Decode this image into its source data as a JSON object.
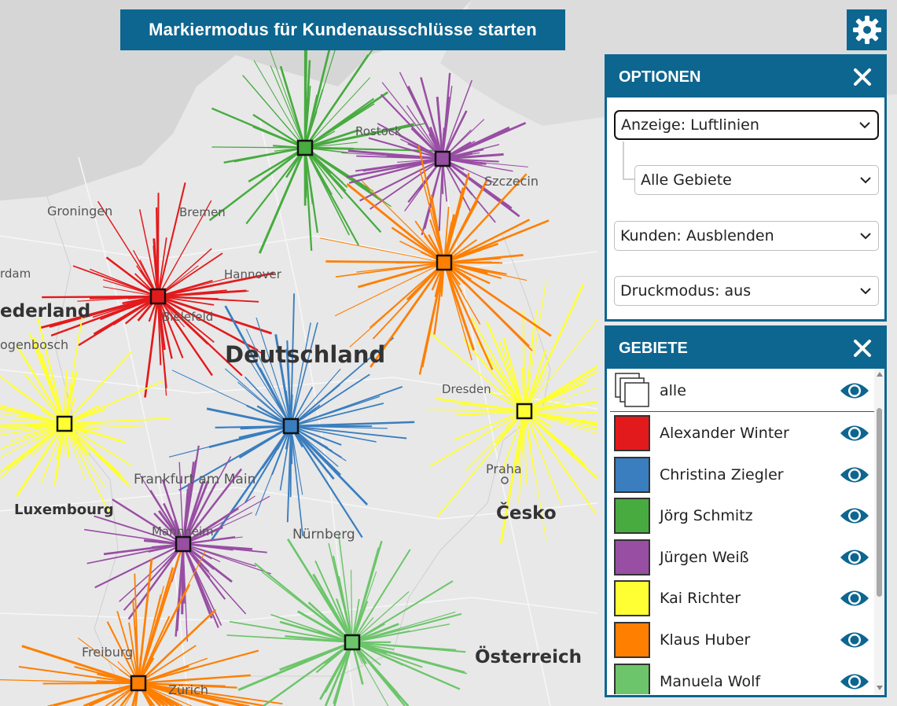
{
  "top_button": {
    "label": "Markiermodus für Kundenausschlüsse starten"
  },
  "settings_icon": "gear-icon",
  "map": {
    "labels": {
      "groningen": "Groningen",
      "amsterdam_part": "rdam",
      "nederland_part": "ederland",
      "hertogenbosch_part": "ogenbosch",
      "deutschland": "Deutschland",
      "frankfurt": "Frankfurt am Main",
      "luxembourg": "Luxembourg",
      "cesko": "Česko",
      "praha": "Praha",
      "nuernberg": "Nürnberg",
      "oesterreich": "Österreich",
      "freiburg": "Freiburg",
      "zuerich": "Zürich",
      "szczecin": "Szczecin",
      "hannover": "Hannover",
      "bremen": "Bremen",
      "bielefeld": "Bielefeld",
      "rostock": "Rostock",
      "mannheim": "Mannheim",
      "dresden": "Dresden"
    }
  },
  "territories": [
    {
      "name": "Alexander Winter",
      "color": "#e31a1c"
    },
    {
      "name": "Christina Ziegler",
      "color": "#3a7ebf"
    },
    {
      "name": "Jörg Schmitz",
      "color": "#47ab3f"
    },
    {
      "name": "Jürgen Weiß",
      "color": "#984ea3"
    },
    {
      "name": "Kai Richter",
      "color": "#ffff33"
    },
    {
      "name": "Klaus Huber",
      "color": "#ff7f00"
    },
    {
      "name": "Manuela Wolf",
      "color": "#6cc56a"
    }
  ],
  "options_panel": {
    "title": "OPTIONEN",
    "display_select": "Anzeige: Luftlinien",
    "area_select": "Alle Gebiete",
    "customers_select": "Kunden: Ausblenden",
    "print_select": "Druckmodus: aus"
  },
  "areas_panel": {
    "title": "GEBIETE",
    "all_label": "alle"
  }
}
